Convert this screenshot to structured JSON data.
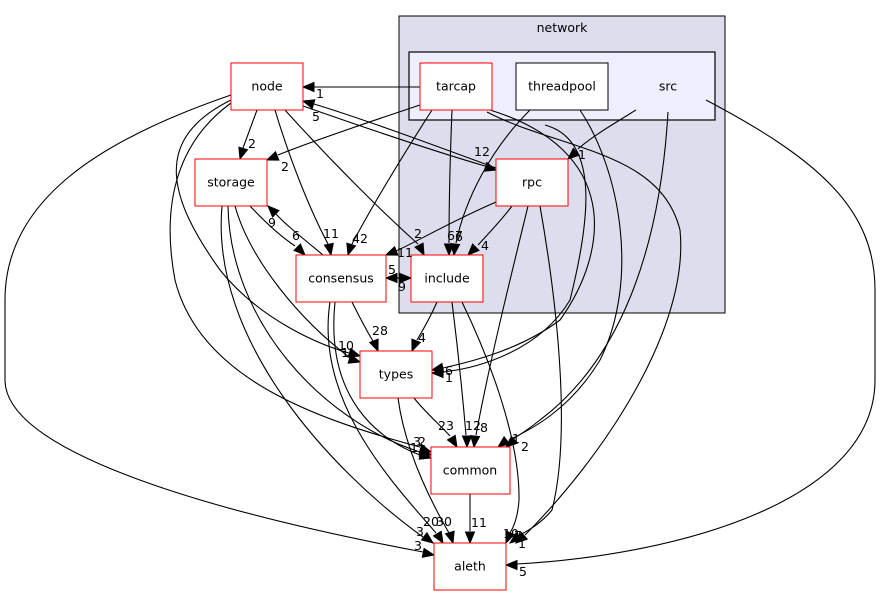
{
  "diagram": {
    "type": "directory-dependency-graph",
    "clusters": [
      {
        "id": "network",
        "label": "network"
      },
      {
        "id": "src",
        "label": "src",
        "parent": "network"
      }
    ],
    "nodes": [
      {
        "id": "node",
        "label": "node",
        "style": "red"
      },
      {
        "id": "storage",
        "label": "storage",
        "style": "red"
      },
      {
        "id": "consensus",
        "label": "consensus",
        "style": "red"
      },
      {
        "id": "include",
        "label": "include",
        "style": "red",
        "cluster": "network"
      },
      {
        "id": "rpc",
        "label": "rpc",
        "style": "red",
        "cluster": "network"
      },
      {
        "id": "tarcap",
        "label": "tarcap",
        "style": "red",
        "cluster": "src"
      },
      {
        "id": "threadpool",
        "label": "threadpool",
        "style": "black",
        "cluster": "src"
      },
      {
        "id": "types",
        "label": "types",
        "style": "red"
      },
      {
        "id": "common",
        "label": "common",
        "style": "red"
      },
      {
        "id": "aleth",
        "label": "aleth",
        "style": "red"
      }
    ],
    "edges": [
      {
        "from": "tarcap",
        "to": "node",
        "label": "1"
      },
      {
        "from": "rpc",
        "to": "node",
        "label": "5"
      },
      {
        "from": "node",
        "to": "rpc",
        "label": "12"
      },
      {
        "from": "node",
        "to": "storage",
        "label": "2"
      },
      {
        "from": "tarcap",
        "to": "storage",
        "label": "2"
      },
      {
        "from": "src",
        "to": "rpc",
        "label": "1"
      },
      {
        "from": "consensus",
        "to": "storage",
        "label": "9"
      },
      {
        "from": "storage",
        "to": "consensus",
        "label": "6"
      },
      {
        "from": "node",
        "to": "consensus",
        "label": "11"
      },
      {
        "from": "tarcap",
        "to": "consensus",
        "label": "42"
      },
      {
        "from": "rpc",
        "to": "consensus",
        "label": "11"
      },
      {
        "from": "node",
        "to": "include",
        "label": "2"
      },
      {
        "from": "tarcap",
        "to": "include",
        "label": "67"
      },
      {
        "from": "threadpool",
        "to": "include",
        "label": "6"
      },
      {
        "from": "rpc",
        "to": "include",
        "label": "4"
      },
      {
        "from": "include",
        "to": "consensus",
        "label": "5"
      },
      {
        "from": "consensus",
        "to": "include",
        "label": "9"
      },
      {
        "from": "consensus",
        "to": "types",
        "label": "28"
      },
      {
        "from": "include",
        "to": "types",
        "label": "4"
      },
      {
        "from": "node",
        "to": "types",
        "label": "10"
      },
      {
        "from": "storage",
        "to": "types",
        "label": "1"
      },
      {
        "from": "tarcap",
        "to": "types",
        "label": "16"
      },
      {
        "from": "rpc",
        "to": "types",
        "label": "1"
      },
      {
        "from": "types",
        "to": "common",
        "label": "23"
      },
      {
        "from": "include",
        "to": "common",
        "label": "12"
      },
      {
        "from": "rpc",
        "to": "common",
        "label": "8"
      },
      {
        "from": "threadpool",
        "to": "common",
        "label": "1"
      },
      {
        "from": "src",
        "to": "common",
        "label": "2"
      },
      {
        "from": "node",
        "to": "common",
        "label": "3"
      },
      {
        "from": "storage",
        "to": "common",
        "label": "2"
      },
      {
        "from": "consensus",
        "to": "common",
        "label": "1"
      },
      {
        "from": "common",
        "to": "aleth",
        "label": "11"
      },
      {
        "from": "types",
        "to": "aleth",
        "label": "30"
      },
      {
        "from": "consensus",
        "to": "aleth",
        "label": "20"
      },
      {
        "from": "storage",
        "to": "aleth",
        "label": "3"
      },
      {
        "from": "node",
        "to": "aleth",
        "label": "3"
      },
      {
        "from": "include",
        "to": "aleth",
        "label": "10"
      },
      {
        "from": "rpc",
        "to": "aleth",
        "label": "7"
      },
      {
        "from": "tarcap",
        "to": "aleth",
        "label": "1"
      },
      {
        "from": "src",
        "to": "aleth",
        "label": "5"
      }
    ]
  }
}
